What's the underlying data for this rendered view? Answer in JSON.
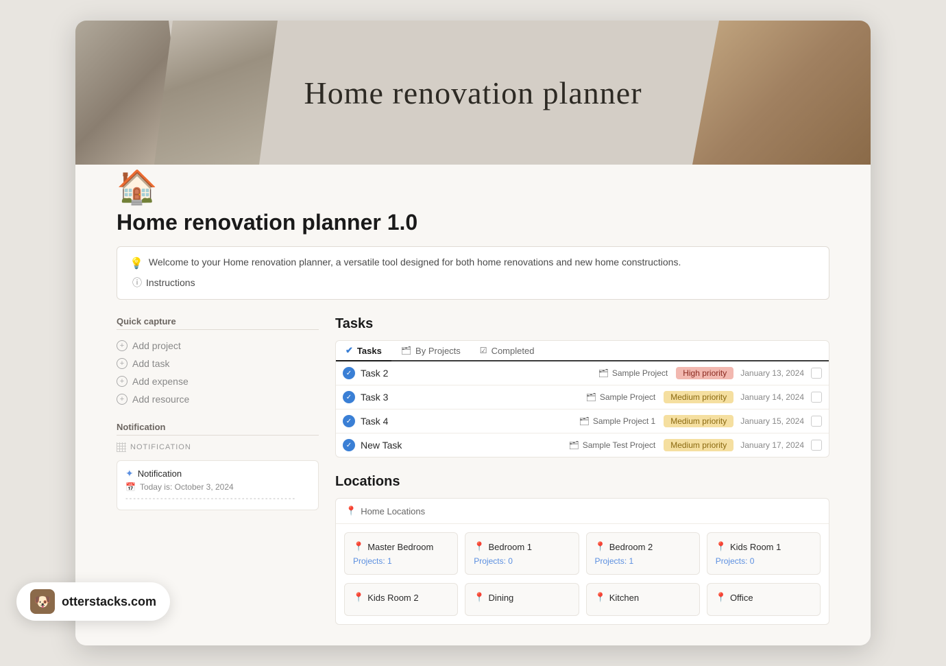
{
  "app": {
    "title": "Home renovation planner"
  },
  "banner": {
    "title": "Home renovation planner"
  },
  "page": {
    "icon": "🏠",
    "title": "Home renovation planner 1.0"
  },
  "welcome": {
    "text": "Welcome to your Home renovation planner, a versatile tool designed for both home renovations and new home constructions.",
    "instructions_label": "Instructions"
  },
  "quick_capture": {
    "title": "Quick capture",
    "items": [
      {
        "label": "Add project"
      },
      {
        "label": "Add task"
      },
      {
        "label": "Add expense"
      },
      {
        "label": "Add resource"
      }
    ]
  },
  "notification": {
    "section_title": "Notification",
    "db_label": "NOTIFICATION",
    "item_title": "Notification",
    "item_date": "Today is: October 3, 2024",
    "divider": "--------------------------------------------"
  },
  "tasks": {
    "title": "Tasks",
    "tabs": [
      {
        "label": "Tasks",
        "active": true
      },
      {
        "label": "By Projects",
        "active": false
      },
      {
        "label": "Completed",
        "active": false
      }
    ],
    "rows": [
      {
        "name": "Task 2",
        "project": "Sample Project",
        "priority": "High priority",
        "priority_type": "high",
        "date": "January 13, 2024"
      },
      {
        "name": "Task 3",
        "project": "Sample Project",
        "priority": "Medium priority",
        "priority_type": "medium",
        "date": "January 14, 2024"
      },
      {
        "name": "Task 4",
        "project": "Sample Project 1",
        "priority": "Medium priority",
        "priority_type": "medium",
        "date": "January 15, 2024"
      },
      {
        "name": "New Task",
        "project": "Sample Test Project",
        "priority": "Medium priority",
        "priority_type": "medium",
        "date": "January 17, 2024"
      }
    ]
  },
  "locations": {
    "title": "Locations",
    "sub_header": "Home Locations",
    "cards_row1": [
      {
        "name": "Master Bedroom",
        "projects": "Projects: 1"
      },
      {
        "name": "Bedroom 1",
        "projects": "Projects: 0"
      },
      {
        "name": "Bedroom 2",
        "projects": "Projects: 1"
      },
      {
        "name": "Kids Room 1",
        "projects": "Projects: 0"
      }
    ],
    "cards_row2": [
      {
        "name": "Kids Room 2",
        "projects": ""
      },
      {
        "name": "Dining",
        "projects": ""
      },
      {
        "name": "Kitchen",
        "projects": ""
      },
      {
        "name": "Office",
        "projects": ""
      }
    ]
  },
  "watermark": {
    "icon": "🐶",
    "label": "otterstacks.com"
  }
}
